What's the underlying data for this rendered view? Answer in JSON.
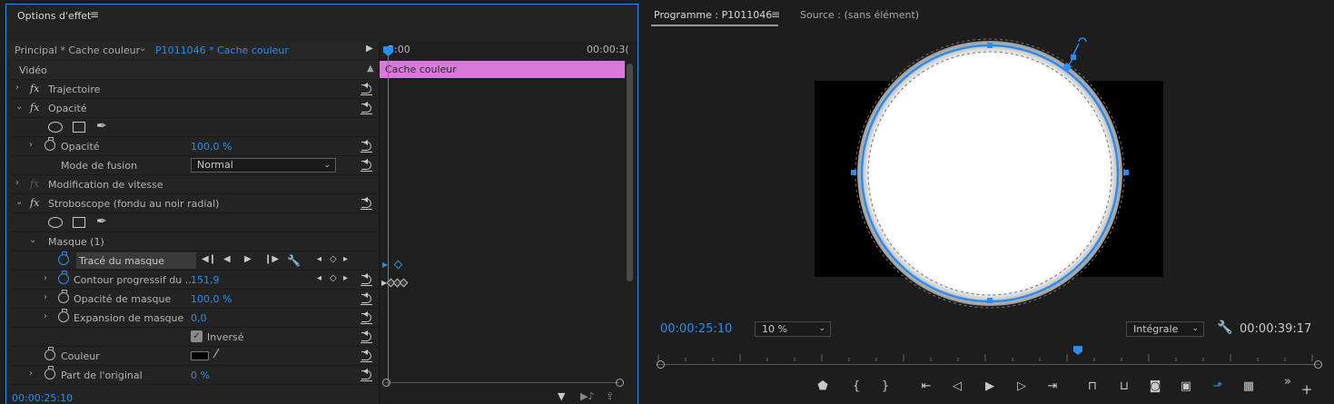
{
  "effect_panel": {
    "title": "Options d'effet",
    "menu_glyph": "≡",
    "source_main": "Principal * Cache couleur",
    "source_clip": "P1011046 * Cache couleur",
    "section_video": "Vidéo",
    "fx_glyph": "fx",
    "rows": {
      "trajectoire": "Trajectoire",
      "opacite_section": "Opacité",
      "opacite_param": "Opacité",
      "opacite_val": "100,0 %",
      "fusion_label": "Mode de fusion",
      "fusion_val": "Normal",
      "vitesse": "Modification de vitesse",
      "strobo": "Stroboscope (fondu au noir radial)",
      "masque": "Masque (1)",
      "trace": "Tracé du masque",
      "contour_label": "Contour progressif du ...",
      "contour_val": "151,9",
      "opmasque_label": "Opacité de masque",
      "opmasque_val": "100,0 %",
      "expansion_label": "Expansion de masque",
      "expansion_val": "0,0",
      "inverse_label": "Inversé",
      "couleur_label": "Couleur",
      "part_label": "Part de l'original",
      "part_val": "0 %"
    },
    "timeline": {
      "start": "5:00",
      "end": "00:00:3(",
      "clip_label": "Cache couleur"
    },
    "footer_time": "00:00:25:10"
  },
  "program_monitor": {
    "tab_label": "Programme : P1011046",
    "menu_glyph": "≡",
    "source_tab": "Source : (sans élément)",
    "timecode_current": "00:00:25:10",
    "zoom": "10 %",
    "resolution": "Intégrale",
    "timecode_duration": "00:00:39:17",
    "overflow_glyph": "»",
    "add_glyph": "+"
  },
  "colors": {
    "accent_blue": "#2d8ceb",
    "clip_pink": "#d87adb",
    "panel_bg": "#232323"
  }
}
